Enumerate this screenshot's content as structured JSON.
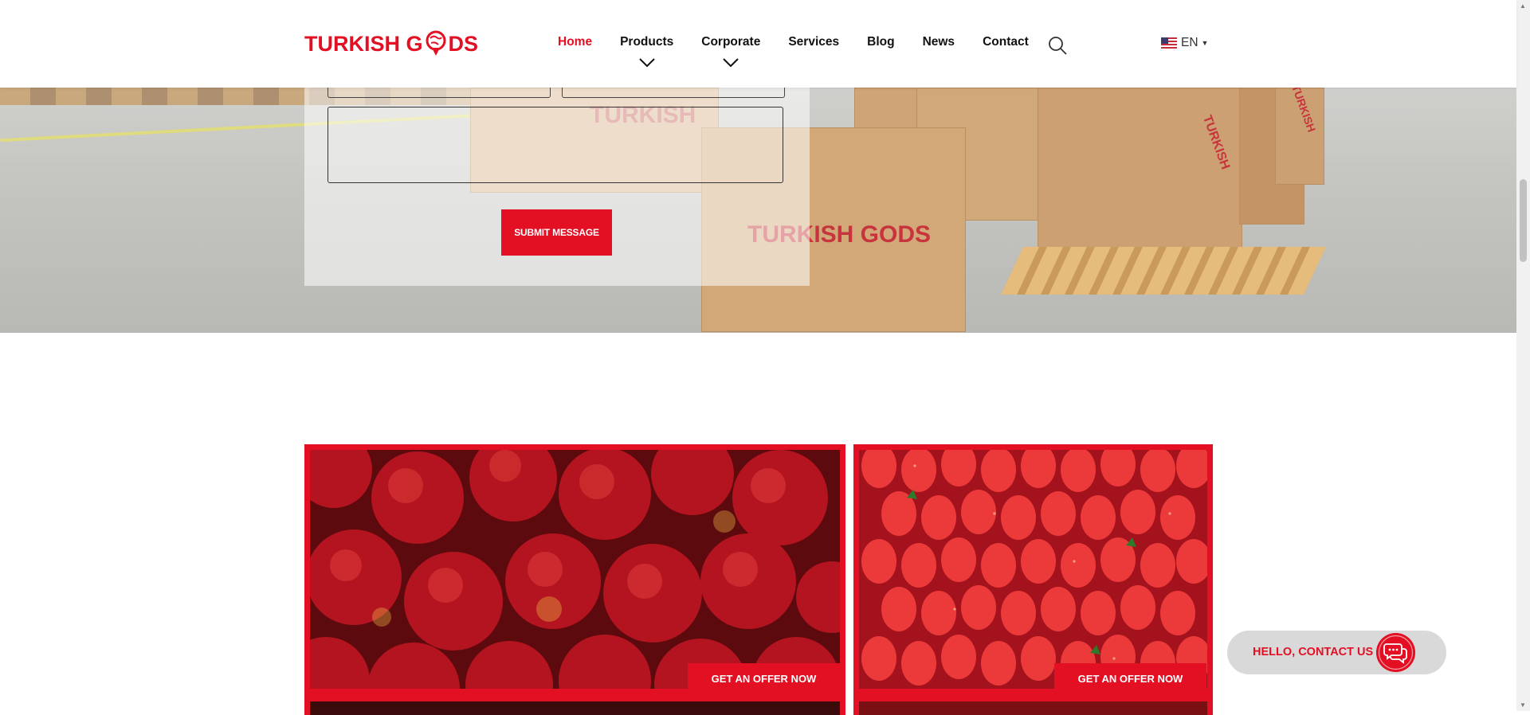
{
  "header": {
    "logo_text_left": "TURKISH G",
    "logo_text_right": "DS",
    "nav": [
      {
        "label": "Home",
        "active": true,
        "has_dropdown": false
      },
      {
        "label": "Products",
        "active": false,
        "has_dropdown": true
      },
      {
        "label": "Corporate",
        "active": false,
        "has_dropdown": true
      },
      {
        "label": "Services",
        "active": false,
        "has_dropdown": false
      },
      {
        "label": "Blog",
        "active": false,
        "has_dropdown": false
      },
      {
        "label": "News",
        "active": false,
        "has_dropdown": false
      },
      {
        "label": "Contact",
        "active": false,
        "has_dropdown": false
      }
    ],
    "search_icon": "search-icon",
    "language": "EN",
    "flag_icon": "us-flag-icon"
  },
  "hero": {
    "box_brand_1": "TURKISH G",
    "box_brand_1b": "DS",
    "box_brand_2": "TURKISH",
    "box_brand_3": "TURKISH GOODS",
    "form": {
      "message_value": "",
      "submit_label": "SUBMIT MESSAGE"
    }
  },
  "products": [
    {
      "name": "apples",
      "offer_label": "GET AN OFFER NOW"
    },
    {
      "name": "strawberries",
      "offer_label": "GET AN OFFER NOW"
    }
  ],
  "contact_float": {
    "label": "HELLO, CONTACT US",
    "icon": "chat-bubbles-icon"
  },
  "colors": {
    "brand_red": "#e30f23",
    "text_dark": "#111111",
    "float_bg": "#d9d9d9"
  }
}
